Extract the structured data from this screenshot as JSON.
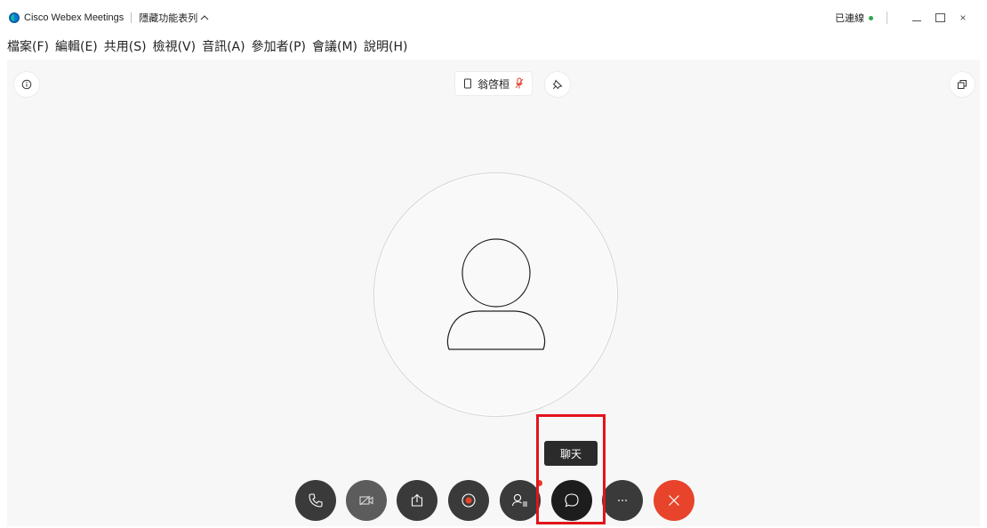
{
  "titlebar": {
    "app_title": "Cisco Webex Meetings",
    "hide_menu_label": "隱藏功能表列",
    "hide_menu_caret": "^",
    "status_label": "已連線",
    "status_color": "#2fa74b",
    "close_glyph": "×"
  },
  "menubar": {
    "items": [
      {
        "label": "檔案(F)"
      },
      {
        "label": "編輯(E)"
      },
      {
        "label": "共用(S)"
      },
      {
        "label": "檢視(V)"
      },
      {
        "label": "音訊(A)"
      },
      {
        "label": "參加者(P)"
      },
      {
        "label": "會議(M)"
      },
      {
        "label": "說明(H)"
      }
    ]
  },
  "stage": {
    "participant_name": "翁啓桓",
    "icons": {
      "info": "info-icon",
      "pin": "pin-icon",
      "popout": "popout-icon",
      "device": "device-icon",
      "mic": "muted-mic-icon"
    }
  },
  "tooltip": {
    "text": "聊天"
  },
  "controls": {
    "items": [
      {
        "name": "audio",
        "icon": "phone-icon"
      },
      {
        "name": "video",
        "icon": "video-off-icon"
      },
      {
        "name": "share",
        "icon": "share-icon"
      },
      {
        "name": "record",
        "icon": "record-icon"
      },
      {
        "name": "participants",
        "icon": "participants-icon"
      },
      {
        "name": "chat",
        "icon": "chat-icon"
      },
      {
        "name": "more",
        "icon": "more-icon"
      },
      {
        "name": "leave",
        "icon": "close-icon"
      }
    ],
    "leave_color": "#e8432b",
    "highlight_color": "#e3141a"
  }
}
